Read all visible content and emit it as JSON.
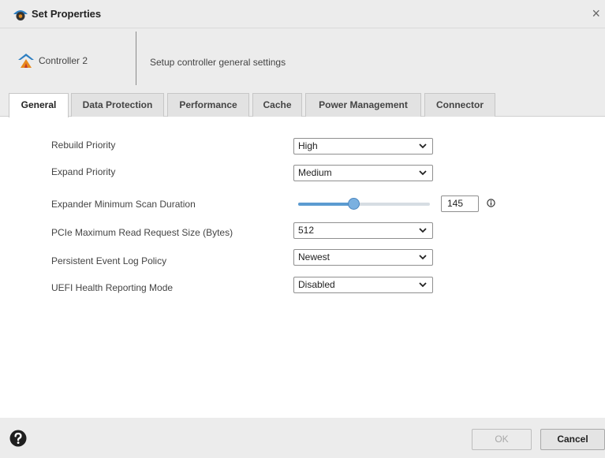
{
  "window": {
    "title": "Set Properties",
    "close_label": "×"
  },
  "header": {
    "controller_name": "Controller 2",
    "description": "Setup controller general settings"
  },
  "tabs": [
    {
      "label": "General",
      "active": true
    },
    {
      "label": "Data Protection",
      "active": false
    },
    {
      "label": "Performance",
      "active": false
    },
    {
      "label": "Cache",
      "active": false
    },
    {
      "label": "Power Management",
      "active": false
    },
    {
      "label": "Connector",
      "active": false
    }
  ],
  "fields": {
    "rebuild_priority": {
      "label": "Rebuild Priority",
      "value": "High"
    },
    "expand_priority": {
      "label": "Expand Priority",
      "value": "Medium"
    },
    "scan_duration": {
      "label": "Expander Minimum Scan Duration",
      "value": "145",
      "slider_fraction": 0.42
    },
    "pcie_read_request": {
      "label": "PCIe Maximum Read Request Size (Bytes)",
      "value": "512"
    },
    "event_log_policy": {
      "label": "Persistent Event Log Policy",
      "value": "Newest"
    },
    "uefi_health": {
      "label": "UEFI Health Reporting Mode",
      "value": "Disabled"
    }
  },
  "footer": {
    "ok_label": "OK",
    "cancel_label": "Cancel"
  },
  "colors": {
    "accent": "#5b9bd1",
    "panel_bg": "#ececec",
    "disabled_text": "#a9a9a9"
  },
  "icons": {
    "app": "gear-icon",
    "controller": "controller-icon",
    "info": "info-icon",
    "help": "help-icon",
    "dropdown": "chevron-down-icon"
  }
}
